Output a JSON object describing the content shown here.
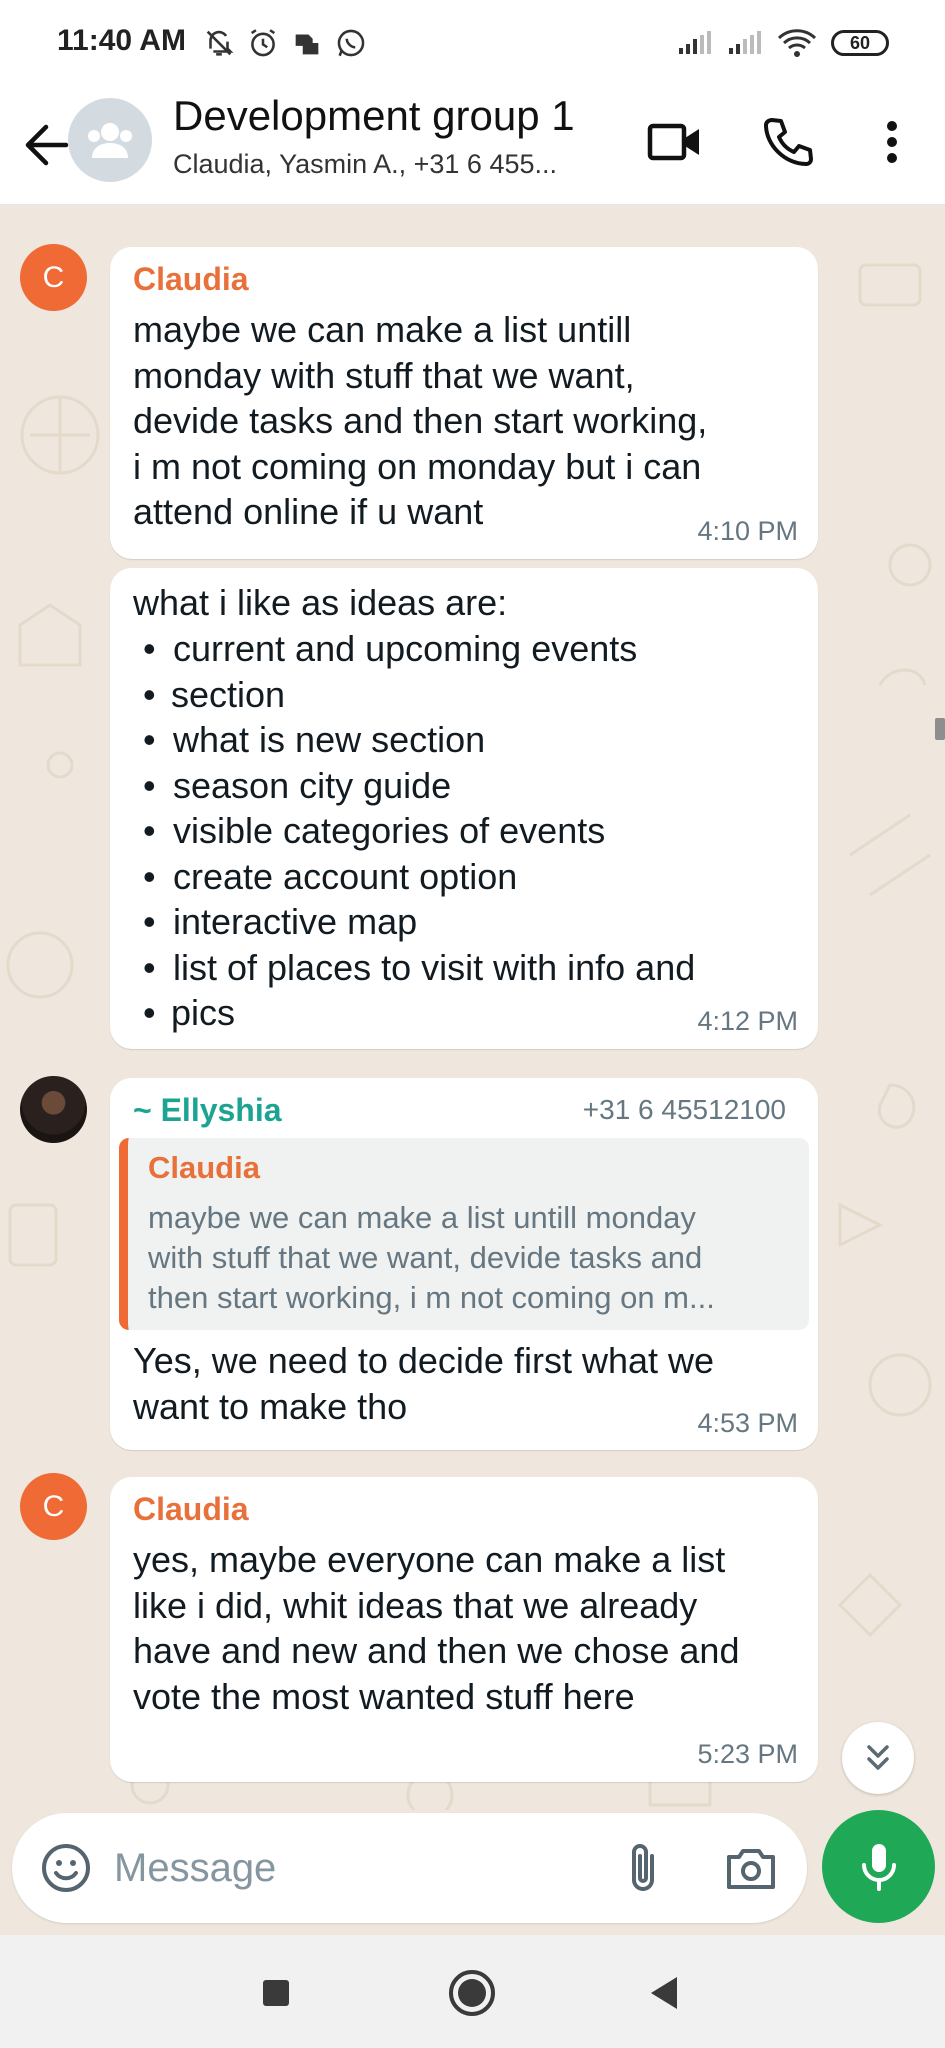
{
  "status_bar": {
    "time": "11:40 AM",
    "battery": "60",
    "icons": [
      "mute-icon",
      "alarm-icon",
      "app-icon",
      "whatsapp-icon",
      "signal-icon",
      "signal-icon",
      "wifi-icon",
      "battery-icon"
    ]
  },
  "header": {
    "title": "Development group 1",
    "subtitle": "Claudia, Yasmin A., +31 6 455..."
  },
  "messages": {
    "m1": {
      "sender": "Claudia",
      "avatar_letter": "C",
      "text_lines": [
        "maybe we can make a list untill",
        "monday with stuff that we want,",
        "devide tasks and then start working,",
        "i m not coming on monday but i can",
        "attend online if u want"
      ],
      "time": "4:10 PM"
    },
    "m2": {
      "intro": "what i like as ideas are:",
      "items": [
        "current and upcoming events",
        "section",
        "what is new section",
        "season city guide",
        "visible categories of events",
        "create account option",
        "interactive map",
        "list of places to visit with info and",
        "pics"
      ],
      "time": "4:12 PM"
    },
    "m3": {
      "sender": "~ Ellyshia",
      "phone": "+31 6 45512100",
      "quote_sender": "Claudia",
      "quote_lines": [
        "maybe we can make a list untill monday",
        "with stuff that we want, devide tasks and",
        "then start working, i m not coming on m..."
      ],
      "text_lines": [
        "Yes, we need to decide first what we",
        "want to make tho"
      ],
      "time": "4:53 PM"
    },
    "m4": {
      "sender": "Claudia",
      "avatar_letter": "C",
      "text_lines": [
        "yes, maybe everyone can make a list",
        "like i did, whit ideas that we already",
        "have and new and then we chose and",
        "vote the most wanted stuff here"
      ],
      "time": "5:23 PM"
    }
  },
  "composer": {
    "placeholder": "Message"
  },
  "colors": {
    "claudia": "#e8703a",
    "ellyshia": "#1da391",
    "mic": "#1fa855",
    "chat_bg": "#efe7dd"
  }
}
